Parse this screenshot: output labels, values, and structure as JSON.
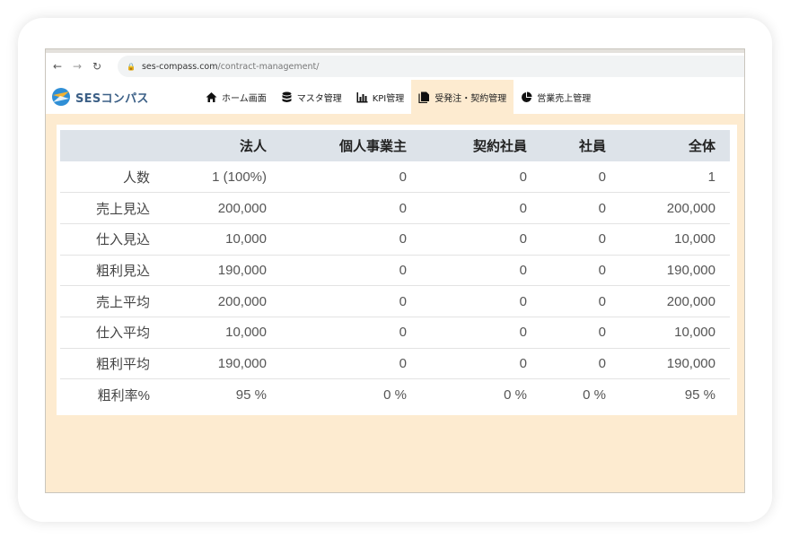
{
  "browser": {
    "address_host": "ses-compass.com",
    "address_path": "/contract-management/"
  },
  "app": {
    "logo_text": "SESコンパス",
    "nav": [
      {
        "label": "ホーム画面",
        "icon": "home-icon"
      },
      {
        "label": "マスタ管理",
        "icon": "database-icon"
      },
      {
        "label": "KPI管理",
        "icon": "bar-chart-icon"
      },
      {
        "label": "受発注・契約管理",
        "icon": "document-icon",
        "active": true
      },
      {
        "label": "営業売上管理",
        "icon": "pie-chart-icon"
      }
    ]
  },
  "table": {
    "headers": [
      "",
      "法人",
      "個人事業主",
      "契約社員",
      "社員",
      "全体"
    ],
    "rows": [
      [
        "人数",
        "1 (100%)",
        "0",
        "0",
        "0",
        "1"
      ],
      [
        "売上見込",
        "200,000",
        "0",
        "0",
        "0",
        "200,000"
      ],
      [
        "仕入見込",
        "10,000",
        "0",
        "0",
        "0",
        "10,000"
      ],
      [
        "粗利見込",
        "190,000",
        "0",
        "0",
        "0",
        "190,000"
      ],
      [
        "売上平均",
        "200,000",
        "0",
        "0",
        "0",
        "200,000"
      ],
      [
        "仕入平均",
        "10,000",
        "0",
        "0",
        "0",
        "10,000"
      ],
      [
        "粗利平均",
        "190,000",
        "0",
        "0",
        "0",
        "190,000"
      ],
      [
        "粗利率%",
        "95 %",
        "0 %",
        "0 %",
        "0 %",
        "95 %"
      ]
    ]
  },
  "colors": {
    "page_bg": "#fdebd0",
    "header_row_bg": "#dde3e9",
    "brand_blue": "#3b5f86",
    "active_tab_bg": "#fdebd0"
  }
}
